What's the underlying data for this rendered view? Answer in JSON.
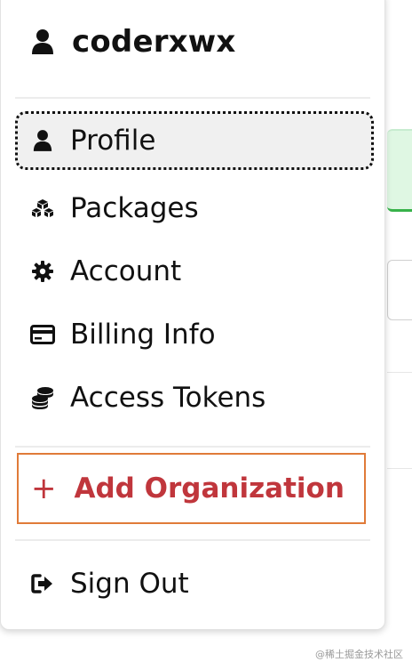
{
  "user": {
    "name": "coderxwx",
    "icon": "user-icon"
  },
  "menu": {
    "items": [
      {
        "label": "Profile",
        "icon": "user-icon"
      },
      {
        "label": "Packages",
        "icon": "cubes-icon"
      },
      {
        "label": "Account",
        "icon": "gear-icon"
      },
      {
        "label": "Billing Info",
        "icon": "credit-card-icon"
      },
      {
        "label": "Access Tokens",
        "icon": "coins-icon"
      }
    ],
    "add_organization": {
      "symbol": "+",
      "label": "Add Organization",
      "icon": "plus-icon"
    },
    "sign_out": {
      "label": "Sign Out",
      "icon": "sign-out-icon"
    }
  },
  "colors": {
    "accent_red": "#c0363c",
    "add_org_border": "#e07b39",
    "active_bg": "#f0f0f0",
    "text": "#111111"
  },
  "watermark": "@稀土掘金技术社区"
}
